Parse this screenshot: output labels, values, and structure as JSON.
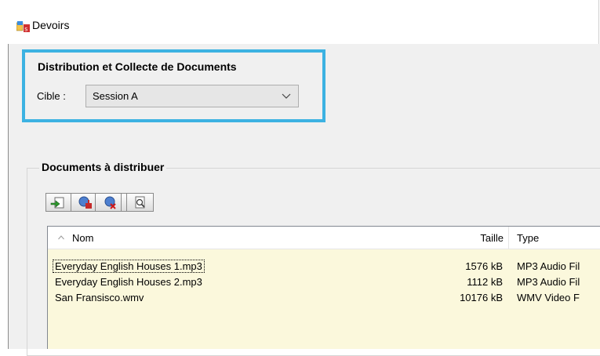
{
  "window": {
    "title": "Devoirs"
  },
  "target_group": {
    "title": "Distribution et Collecte de Documents",
    "cible_label": "Cible :",
    "cible_value": "Session A"
  },
  "documents": {
    "title": "Documents à distribuer",
    "toolbar": [
      "add-document-icon",
      "distribute-icon",
      "remove-document-icon",
      "preview-icon"
    ],
    "columns": {
      "name": "Nom",
      "size": "Taille",
      "type": "Type"
    },
    "rows": [
      {
        "name": "Everyday English Houses 1.mp3",
        "size": "1576 kB",
        "type": "MP3 Audio Fil"
      },
      {
        "name": "Everyday English Houses 2.mp3",
        "size": "1112 kB",
        "type": "MP3 Audio Fil"
      },
      {
        "name": "San Fransisco.wmv",
        "size": "10176 kB",
        "type": "WMV Video F"
      }
    ]
  },
  "colors": {
    "highlight": "#3cb2e2",
    "list_bg": "#fbf8dc"
  }
}
